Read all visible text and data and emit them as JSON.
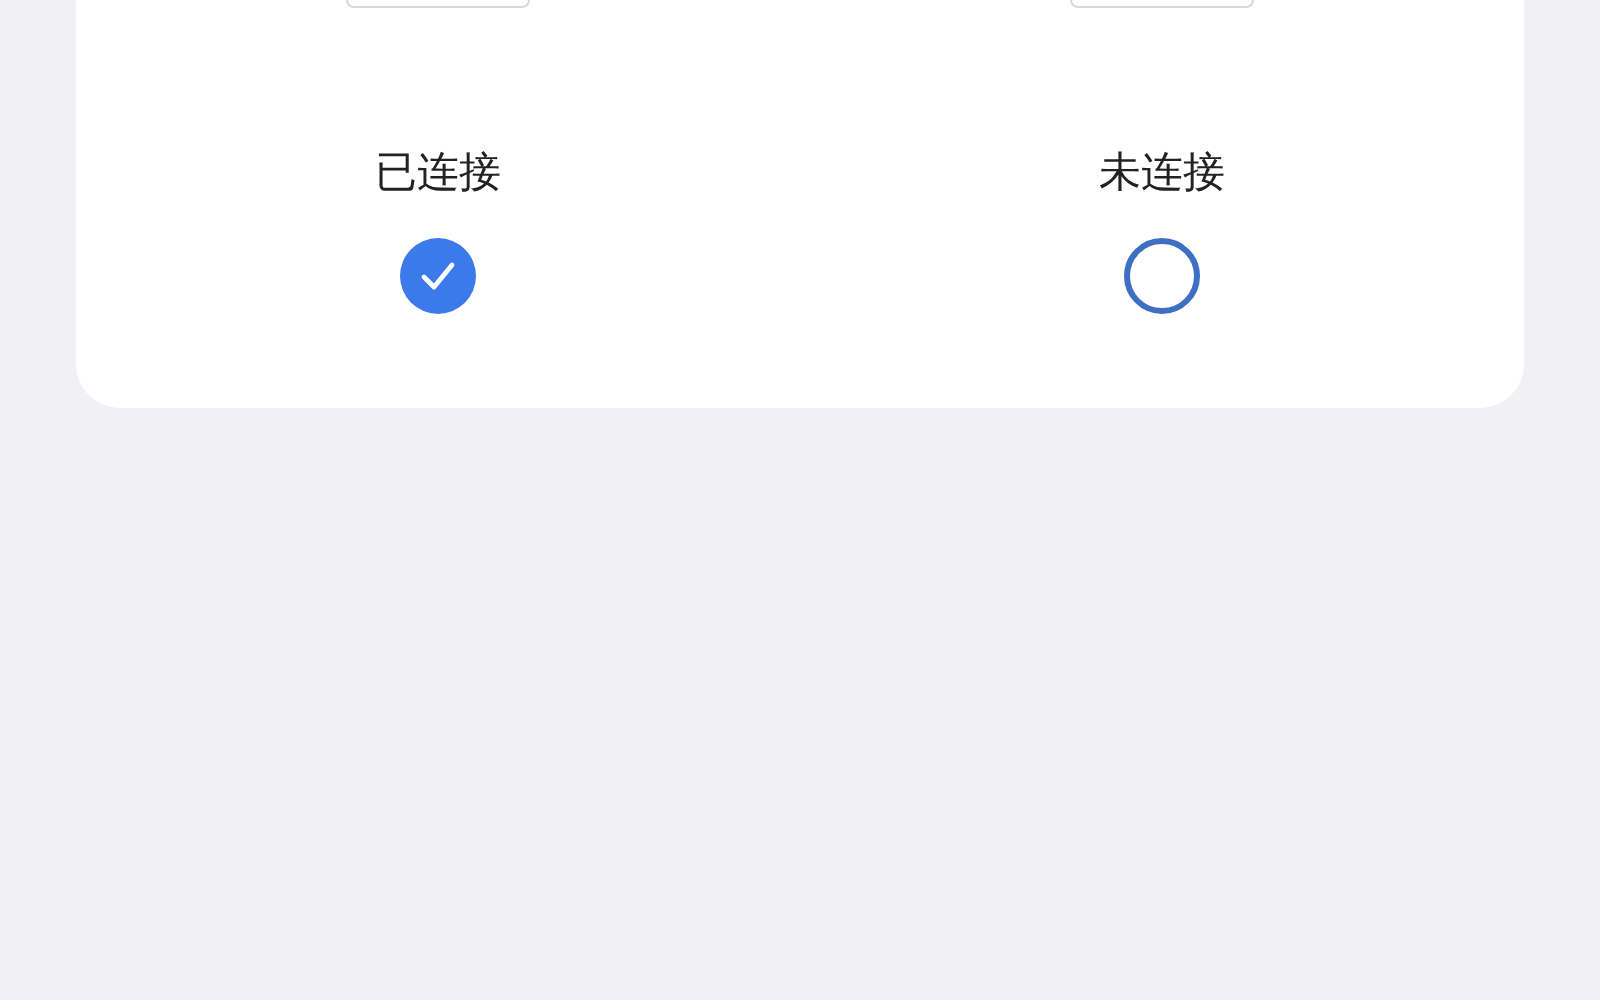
{
  "options": [
    {
      "label": "已连接",
      "selected": true
    },
    {
      "label": "未连接",
      "selected": false
    }
  ]
}
